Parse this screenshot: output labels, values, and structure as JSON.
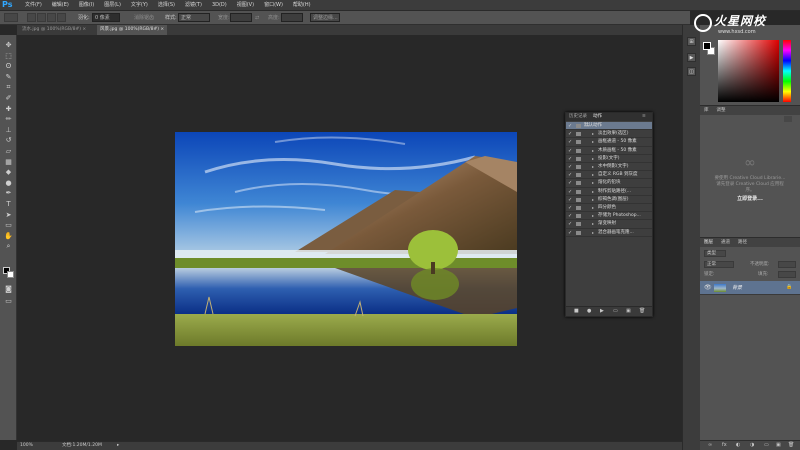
{
  "app": {
    "logo": "Ps"
  },
  "menu": [
    "文件(F)",
    "编辑(E)",
    "图像(I)",
    "图层(L)",
    "文字(Y)",
    "选择(S)",
    "滤镜(T)",
    "3D(D)",
    "视图(V)",
    "窗口(W)",
    "帮助(H)"
  ],
  "options": {
    "feather_label": "羽化:",
    "feather_value": "0 像素",
    "antialias": "消除锯齿",
    "style_label": "样式:",
    "style_value": "正常",
    "width_label": "宽度:",
    "height_label": "高度:",
    "refine_edge": "调整边缘..."
  },
  "tabs": [
    {
      "label": "流水.jpg @ 100%(RGB/8#)",
      "active": false
    },
    {
      "label": "风景.jpg @ 100%(RGB/8#)",
      "active": true
    }
  ],
  "status": {
    "zoom": "100%",
    "doc": "文档:1.20M/1.20M"
  },
  "actions_panel": {
    "tabs": [
      "历史记录",
      "动作"
    ],
    "items": [
      {
        "label": "默认动作",
        "checked": true,
        "selected": true
      },
      {
        "label": "淡出效果(选区)",
        "checked": true,
        "selected": false
      },
      {
        "label": "画框通道 - 50 像素",
        "checked": true,
        "selected": false
      },
      {
        "label": "木质画框 - 50 像素",
        "checked": true,
        "selected": false
      },
      {
        "label": "投影(文字)",
        "checked": true,
        "selected": false
      },
      {
        "label": "水中倒影(文字)",
        "checked": true,
        "selected": false
      },
      {
        "label": "自定义 RGB 到灰度",
        "checked": true,
        "selected": false
      },
      {
        "label": "熔化的铅块",
        "checked": true,
        "selected": false
      },
      {
        "label": "制作剪贴路径(...",
        "checked": true,
        "selected": false
      },
      {
        "label": "棕褐色调(图层)",
        "checked": true,
        "selected": false
      },
      {
        "label": "四分颜色",
        "checked": true,
        "selected": false
      },
      {
        "label": "存储为 Photoshop...",
        "checked": true,
        "selected": false
      },
      {
        "label": "渐变映射",
        "checked": true,
        "selected": false
      },
      {
        "label": "混合器画笔克隆...",
        "checked": true,
        "selected": false
      }
    ]
  },
  "cc_panel": {
    "tabs": [
      "库",
      "调整"
    ],
    "message": "要使用 Creative Cloud Librarie... 请先登录 Creative Cloud 应用程序。",
    "login": "立即登录..."
  },
  "layers_panel": {
    "tabs": [
      "图层",
      "通道",
      "路径"
    ],
    "kind": "类型",
    "blend": "正常",
    "opacity_label": "不透明度:",
    "lock_label": "锁定:",
    "fill_label": "填充:",
    "layer_name": "背景"
  },
  "watermark": {
    "text": "火星网校",
    "url": "www.hxsd.com"
  },
  "colors": {
    "accent": "#31a8ff",
    "selected_row": "#6b7a8f",
    "layer_selected": "#5e7390"
  }
}
